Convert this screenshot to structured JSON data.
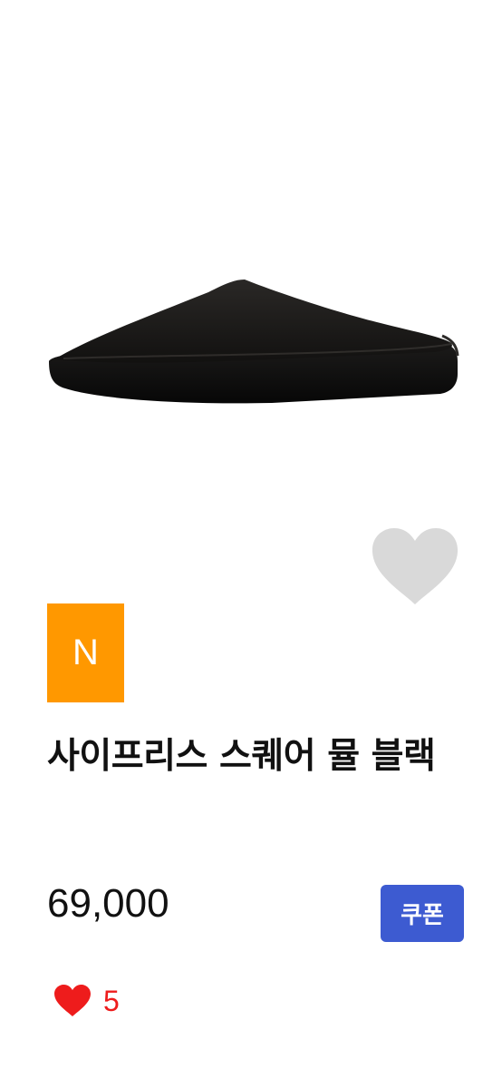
{
  "product": {
    "badge_label": "N",
    "title": "사이프리스 스퀘어 뮬 블랙",
    "price": "69,000",
    "coupon_label": "쿠폰",
    "like_count": "5"
  },
  "icons": {
    "wishlist": "heart-outline-icon",
    "like": "heart-icon"
  },
  "colors": {
    "badge": "#ff9800",
    "coupon": "#3d5bd1",
    "like": "#ee1c1c",
    "wishlist": "#d9d9d9"
  }
}
